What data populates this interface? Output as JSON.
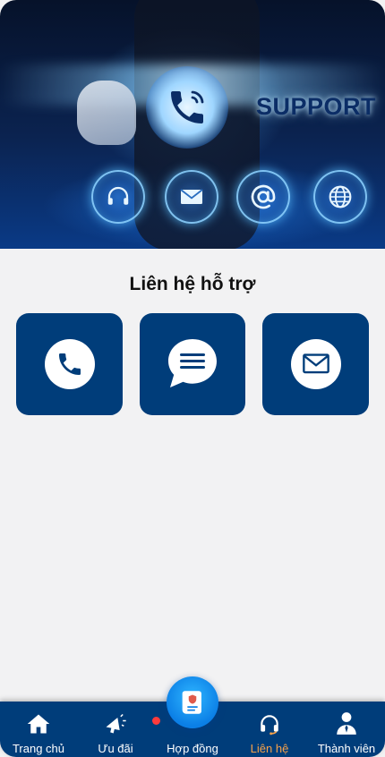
{
  "banner": {
    "title": "SUPPORT"
  },
  "page": {
    "heading": "Liên hệ hỗ trợ"
  },
  "contact_options": [
    {
      "icon": "phone-icon"
    },
    {
      "icon": "chat-message-icon"
    },
    {
      "icon": "mail-icon"
    }
  ],
  "tabbar": {
    "items": [
      {
        "label": "Trang chủ",
        "icon": "home-icon"
      },
      {
        "label": "Ưu đãi",
        "icon": "promo-megaphone-icon"
      },
      {
        "label": "Hợp đồng",
        "icon": "contract-document-icon"
      },
      {
        "label": "Liên hệ",
        "icon": "headset-icon"
      },
      {
        "label": "Thành viên",
        "icon": "member-profile-icon"
      }
    ],
    "active_index": 3
  },
  "colors": {
    "primary": "#003d7a",
    "active_tab": "#f7a24a",
    "background": "#f2f2f3",
    "badge": "#ff3b3b",
    "center_button": "#0b7fe6"
  }
}
